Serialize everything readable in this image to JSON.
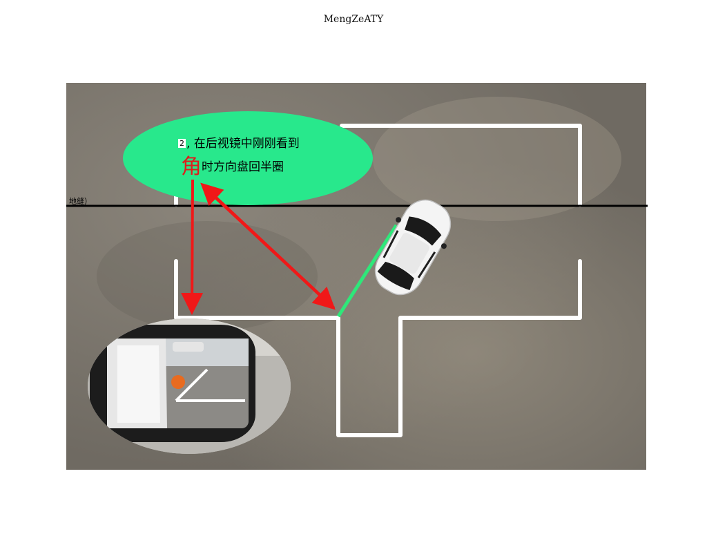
{
  "page": {
    "title": "MengZeATY"
  },
  "diagram": {
    "callout": {
      "step_number": "2",
      "line1_text": ", 在后视镜中刚刚看到",
      "highlight_char": "角",
      "line2_text": "时方向盘回半圈"
    },
    "ground_line_label": "地缝）",
    "colors": {
      "ground": "#7d786f",
      "callout_fill": "#28e88c",
      "parking_lines": "#ffffff",
      "arrow": "#f01818",
      "guide_line": "#2ee87a",
      "ground_seam": "#000000",
      "highlight_text": "#e01b1b"
    }
  }
}
